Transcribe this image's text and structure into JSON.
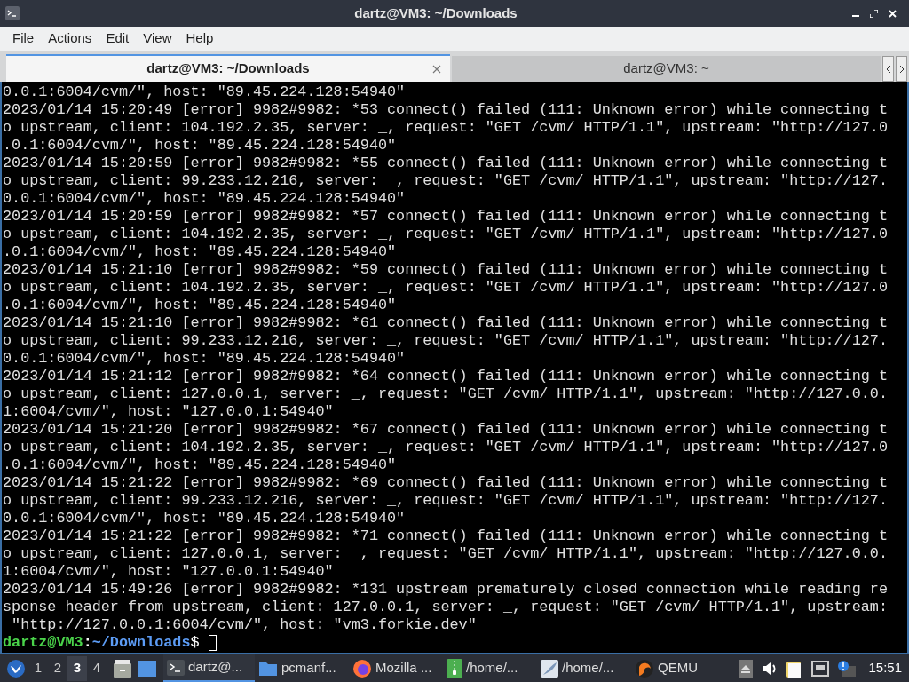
{
  "window": {
    "title": "dartz@VM3: ~/Downloads"
  },
  "menu": [
    "File",
    "Actions",
    "Edit",
    "View",
    "Help"
  ],
  "tabs": [
    {
      "label": "dartz@VM3: ~/Downloads",
      "selected": true
    },
    {
      "label": "dartz@VM3: ~",
      "selected": false
    }
  ],
  "terminal": {
    "lines": [
      "0.0.1:6004/cvm/\", host: \"89.45.224.128:54940\"",
      "2023/01/14 15:20:49 [error] 9982#9982: *53 connect() failed (111: Unknown error) while connecting t",
      "o upstream, client: 104.192.2.35, server: _, request: \"GET /cvm/ HTTP/1.1\", upstream: \"http://127.0",
      ".0.1:6004/cvm/\", host: \"89.45.224.128:54940\"",
      "2023/01/14 15:20:59 [error] 9982#9982: *55 connect() failed (111: Unknown error) while connecting t",
      "o upstream, client: 99.233.12.216, server: _, request: \"GET /cvm/ HTTP/1.1\", upstream: \"http://127.",
      "0.0.1:6004/cvm/\", host: \"89.45.224.128:54940\"",
      "2023/01/14 15:20:59 [error] 9982#9982: *57 connect() failed (111: Unknown error) while connecting t",
      "o upstream, client: 104.192.2.35, server: _, request: \"GET /cvm/ HTTP/1.1\", upstream: \"http://127.0",
      ".0.1:6004/cvm/\", host: \"89.45.224.128:54940\"",
      "2023/01/14 15:21:10 [error] 9982#9982: *59 connect() failed (111: Unknown error) while connecting t",
      "o upstream, client: 104.192.2.35, server: _, request: \"GET /cvm/ HTTP/1.1\", upstream: \"http://127.0",
      ".0.1:6004/cvm/\", host: \"89.45.224.128:54940\"",
      "2023/01/14 15:21:10 [error] 9982#9982: *61 connect() failed (111: Unknown error) while connecting t",
      "o upstream, client: 99.233.12.216, server: _, request: \"GET /cvm/ HTTP/1.1\", upstream: \"http://127.",
      "0.0.1:6004/cvm/\", host: \"89.45.224.128:54940\"",
      "2023/01/14 15:21:12 [error] 9982#9982: *64 connect() failed (111: Unknown error) while connecting t",
      "o upstream, client: 127.0.0.1, server: _, request: \"GET /cvm/ HTTP/1.1\", upstream: \"http://127.0.0.",
      "1:6004/cvm/\", host: \"127.0.0.1:54940\"",
      "2023/01/14 15:21:20 [error] 9982#9982: *67 connect() failed (111: Unknown error) while connecting t",
      "o upstream, client: 104.192.2.35, server: _, request: \"GET /cvm/ HTTP/1.1\", upstream: \"http://127.0",
      ".0.1:6004/cvm/\", host: \"89.45.224.128:54940\"",
      "2023/01/14 15:21:22 [error] 9982#9982: *69 connect() failed (111: Unknown error) while connecting t",
      "o upstream, client: 99.233.12.216, server: _, request: \"GET /cvm/ HTTP/1.1\", upstream: \"http://127.",
      "0.0.1:6004/cvm/\", host: \"89.45.224.128:54940\"",
      "2023/01/14 15:21:22 [error] 9982#9982: *71 connect() failed (111: Unknown error) while connecting t",
      "o upstream, client: 127.0.0.1, server: _, request: \"GET /cvm/ HTTP/1.1\", upstream: \"http://127.0.0.",
      "1:6004/cvm/\", host: \"127.0.0.1:54940\"",
      "2023/01/14 15:49:26 [error] 9982#9982: *131 upstream prematurely closed connection while reading re",
      "sponse header from upstream, client: 127.0.0.1, server: _, request: \"GET /cvm/ HTTP/1.1\", upstream:",
      " \"http://127.0.0.1:6004/cvm/\", host: \"vm3.forkie.dev\""
    ],
    "prompt": {
      "user": "dartz@VM3",
      "separator": ":",
      "path": "~/Downloads",
      "symbol": "$"
    }
  },
  "taskbar": {
    "workspaces": [
      {
        "label": "1",
        "selected": false
      },
      {
        "label": "2",
        "selected": false
      },
      {
        "label": "3",
        "selected": true
      },
      {
        "label": "4",
        "selected": false
      }
    ],
    "tasks": [
      {
        "kind": "terminal",
        "label": "dartz@...",
        "selected": true
      },
      {
        "kind": "folder",
        "label": "pcmanf...",
        "selected": false
      },
      {
        "kind": "browser",
        "label": "Mozilla ...",
        "selected": false
      },
      {
        "kind": "archive",
        "label": "/home/...",
        "selected": false
      },
      {
        "kind": "editor",
        "label": "/home/...",
        "selected": false
      },
      {
        "kind": "emulator",
        "label": "QEMU",
        "selected": false
      }
    ],
    "clock": "15:51"
  }
}
